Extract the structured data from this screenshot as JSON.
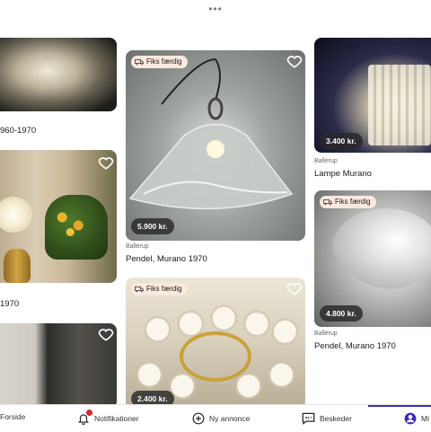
{
  "top_handle": "•••",
  "listings": {
    "left_top": {
      "title": "960-1970"
    },
    "left_mid": {
      "title": "1970"
    },
    "center_top": {
      "badge": "Fiks færdig",
      "price": "5.900 kr.",
      "location": "Ballerup",
      "title": "Pendel, Murano 1970"
    },
    "center_bottom": {
      "badge": "Fiks færdig",
      "price": "2.400 kr."
    },
    "right_top": {
      "price": "3.400 kr.",
      "location": "Ballerup",
      "title": "Lampe Murano"
    },
    "right_mid": {
      "badge": "Fiks færdig",
      "price": "4.800 kr.",
      "location": "Ballerup",
      "title": "Pendel, Murano 1970"
    }
  },
  "bottom_nav": {
    "home": "Forside",
    "notifications": "Notifikationer",
    "new_ad": "Ny annonce",
    "messages": "Beskeder",
    "profile": "Mi"
  },
  "colors": {
    "badge_bg": "#fbe8de",
    "price_bg": "#282828",
    "accent": "#3c2bb4",
    "notification_dot": "#d62828"
  },
  "icons": [
    "heart-icon",
    "box-icon",
    "bell-icon",
    "plus-circle-icon",
    "chat-icon",
    "profile-icon"
  ]
}
